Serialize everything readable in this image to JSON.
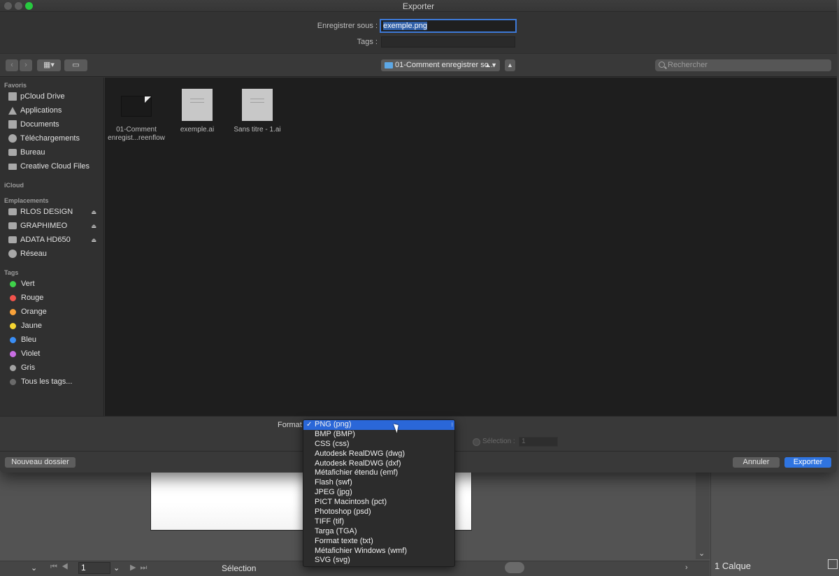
{
  "window": {
    "title": "Exporter"
  },
  "save": {
    "label": "Enregistrer sous :",
    "filename": "exemple.png",
    "tags_label": "Tags :"
  },
  "toolbar": {
    "location": "01-Comment enregistrer so...",
    "search_placeholder": "Rechercher"
  },
  "sidebar": {
    "favorites_header": "Favoris",
    "favorites": [
      {
        "label": "pCloud Drive",
        "icon": "document-icon"
      },
      {
        "label": "Applications",
        "icon": "applications-icon"
      },
      {
        "label": "Documents",
        "icon": "document-icon"
      },
      {
        "label": "Téléchargements",
        "icon": "download-icon"
      },
      {
        "label": "Bureau",
        "icon": "desktop-icon"
      },
      {
        "label": "Creative Cloud Files",
        "icon": "folder-icon"
      }
    ],
    "icloud_header": "iCloud",
    "locations_header": "Emplacements",
    "locations": [
      {
        "label": "RLOS DESIGN",
        "icon": "drive-icon"
      },
      {
        "label": "GRAPHIMEO",
        "icon": "drive-icon"
      },
      {
        "label": "ADATA HD650",
        "icon": "drive-icon"
      },
      {
        "label": "Réseau",
        "icon": "network-icon"
      }
    ],
    "tags_header": "Tags",
    "tags": [
      {
        "label": "Vert",
        "color": "#3fd24a"
      },
      {
        "label": "Rouge",
        "color": "#f2534c"
      },
      {
        "label": "Orange",
        "color": "#f9a23a"
      },
      {
        "label": "Jaune",
        "color": "#f6d532"
      },
      {
        "label": "Bleu",
        "color": "#3a8ef5"
      },
      {
        "label": "Violet",
        "color": "#c86ee2"
      },
      {
        "label": "Gris",
        "color": "#a3a3a3"
      },
      {
        "label": "Tous les tags...",
        "color": "#6a6a6a"
      }
    ]
  },
  "files": [
    {
      "line1": "01-Comment",
      "line2": "enregist...reenflow"
    },
    {
      "line1": "exemple.ai",
      "line2": ""
    },
    {
      "line1": "Sans titre - 1.ai",
      "line2": ""
    }
  ],
  "options": {
    "format_label": "Format",
    "selection_label": "Sélection :",
    "selection_value": "1"
  },
  "format_menu": {
    "selected": "PNG (png)",
    "items": [
      "PNG (png)",
      "BMP (BMP)",
      "CSS (css)",
      "Autodesk RealDWG (dwg)",
      "Autodesk RealDWG (dxf)",
      "Métafichier étendu (emf)",
      "Flash (swf)",
      "JPEG (jpg)",
      "PICT Macintosh (pct)",
      "Photoshop (psd)",
      "TIFF (tif)",
      "Targa (TGA)",
      "Format texte (txt)",
      "Métafichier Windows (wmf)",
      "SVG (svg)"
    ]
  },
  "footer": {
    "new_folder": "Nouveau dossier",
    "cancel": "Annuler",
    "export": "Exporter"
  },
  "background_app": {
    "page_number": "1",
    "status": "Sélection",
    "layers": "1 Calque"
  }
}
